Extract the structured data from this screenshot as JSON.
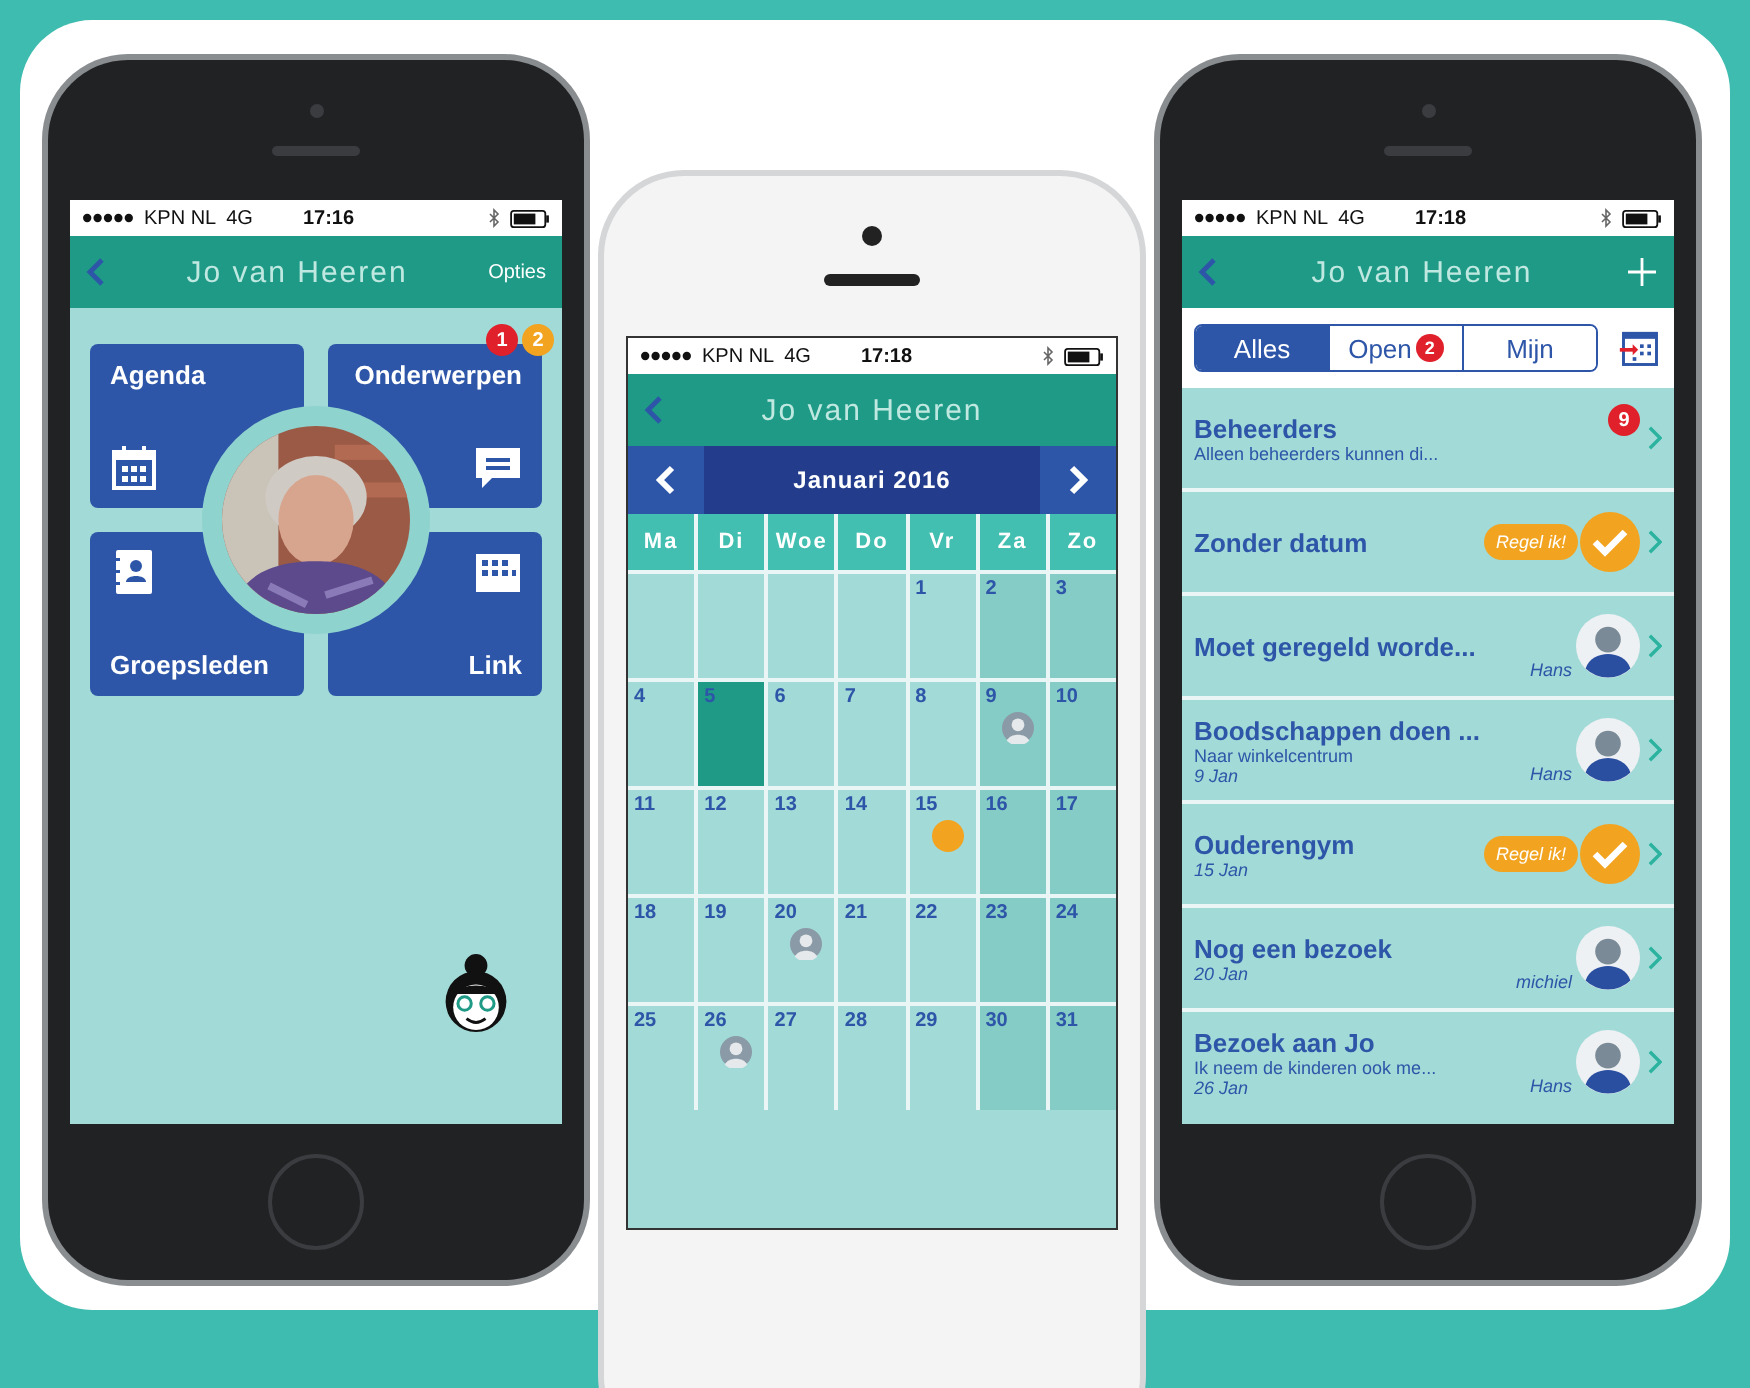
{
  "home_phone": {
    "status": {
      "carrier": "KPN NL",
      "network": "4G",
      "time": "17:16"
    },
    "header": {
      "title": "Jo van Heeren",
      "action": "Opties"
    },
    "tiles": [
      {
        "label": "Agenda"
      },
      {
        "label": "Onderwerpen"
      },
      {
        "label": "Groepsleden"
      },
      {
        "label": "Link"
      }
    ],
    "badges": [
      {
        "count": "1",
        "color": "#e0202a"
      },
      {
        "count": "2",
        "color": "#f2a31f"
      }
    ]
  },
  "calendar_phone": {
    "status": {
      "carrier": "KPN NL",
      "network": "4G",
      "time": "17:18"
    },
    "header": {
      "title": "Jo van Heeren"
    },
    "month": "Januari 2016",
    "weekdays": [
      "Ma",
      "Di",
      "Woe",
      "Do",
      "Vr",
      "Za",
      "Zo"
    ],
    "weeks": [
      [
        {
          "kind": "empty",
          "selected": false
        },
        {
          "kind": "empty",
          "selected": false
        },
        {
          "kind": "empty",
          "selected": false
        },
        {
          "kind": "empty",
          "selected": false
        },
        {
          "kind": "day",
          "day": "1",
          "selected": false
        },
        {
          "kind": "day",
          "day": "2",
          "selected": false
        },
        {
          "kind": "day",
          "day": "3",
          "selected": false
        }
      ],
      [
        {
          "kind": "day",
          "day": "4",
          "selected": false
        },
        {
          "kind": "day",
          "day": "5",
          "selected": true
        },
        {
          "kind": "day",
          "day": "6",
          "selected": false
        },
        {
          "kind": "day",
          "day": "7",
          "selected": false
        },
        {
          "kind": "day",
          "day": "8",
          "selected": false
        },
        {
          "kind": "avatar",
          "day": "9",
          "selected": false
        },
        {
          "kind": "day",
          "day": "10",
          "selected": false
        }
      ],
      [
        {
          "kind": "day",
          "day": "11",
          "selected": false
        },
        {
          "kind": "day",
          "day": "12",
          "selected": false
        },
        {
          "kind": "day",
          "day": "13",
          "selected": false
        },
        {
          "kind": "day",
          "day": "14",
          "selected": false
        },
        {
          "kind": "dot",
          "day": "15",
          "selected": false
        },
        {
          "kind": "day",
          "day": "16",
          "selected": false
        },
        {
          "kind": "day",
          "day": "17",
          "selected": false
        }
      ],
      [
        {
          "kind": "day",
          "day": "18",
          "selected": false
        },
        {
          "kind": "day",
          "day": "19",
          "selected": false
        },
        {
          "kind": "avatar",
          "day": "20",
          "selected": false
        },
        {
          "kind": "day",
          "day": "21",
          "selected": false
        },
        {
          "kind": "day",
          "day": "22",
          "selected": false
        },
        {
          "kind": "day",
          "day": "23",
          "selected": false
        },
        {
          "kind": "day",
          "day": "24",
          "selected": false
        }
      ],
      [
        {
          "kind": "day",
          "day": "25",
          "selected": false
        },
        {
          "kind": "avatar",
          "day": "26",
          "selected": false
        },
        {
          "kind": "day",
          "day": "27",
          "selected": false
        },
        {
          "kind": "day",
          "day": "28",
          "selected": false
        },
        {
          "kind": "day",
          "day": "29",
          "selected": false
        },
        {
          "kind": "day",
          "day": "30",
          "selected": false
        },
        {
          "kind": "day",
          "day": "31",
          "selected": false
        }
      ]
    ]
  },
  "list_phone": {
    "status": {
      "carrier": "KPN NL",
      "network": "4G",
      "time": "17:18"
    },
    "header": {
      "title": "Jo van Heeren"
    },
    "segments": [
      {
        "label": "Alles",
        "selected": true
      },
      {
        "label": "Open",
        "selected": false,
        "badge": "2"
      },
      {
        "label": "Mijn",
        "selected": false
      }
    ],
    "items": [
      {
        "kind": "badge",
        "title": "Beheerders",
        "subtitle": "Alleen beheerders kunnen di...",
        "badge": "9"
      },
      {
        "kind": "claim",
        "title": "Zonder datum",
        "claim": "Regel ik!"
      },
      {
        "kind": "avatar",
        "title": "Moet geregeld worde...",
        "person": "Hans"
      },
      {
        "kind": "avatar",
        "title": "Boodschappen doen ...",
        "subtitle": "Naar winkelcentrum",
        "date": "9 Jan",
        "person": "Hans"
      },
      {
        "kind": "claim",
        "title": "Ouderengym",
        "date": "15 Jan",
        "claim": "Regel ik!"
      },
      {
        "kind": "avatar",
        "title": "Nog een bezoek",
        "date": "20 Jan",
        "person": "michiel"
      },
      {
        "kind": "avatar",
        "title": "Bezoek aan Jo",
        "subtitle": "Ik neem de kinderen ook me...",
        "date": "26 Jan",
        "person": "Hans"
      }
    ]
  }
}
